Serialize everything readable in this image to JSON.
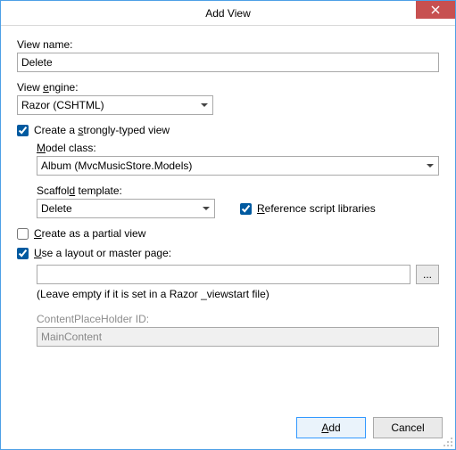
{
  "window": {
    "title": "Add View"
  },
  "fields": {
    "viewName": {
      "label": "View name:",
      "value": "Delete"
    },
    "viewEngine": {
      "label_pre": "View ",
      "label_u": "e",
      "label_post": "ngine:",
      "value": "Razor (CSHTML)"
    }
  },
  "strong": {
    "checkbox_pre": "Create a ",
    "checkbox_u": "s",
    "checkbox_post": "trongly-typed view",
    "checked": true,
    "modelClass": {
      "label_u": "M",
      "label_post": "odel class:",
      "value": "Album (MvcMusicStore.Models)"
    },
    "scaffold": {
      "label_pre": "Scaffol",
      "label_u": "d",
      "label_post": " template:",
      "value": "Delete"
    },
    "referenceScripts": {
      "checked": true,
      "label_u": "R",
      "label_post": "eference script libraries"
    }
  },
  "partial": {
    "checked": false,
    "label_u": "C",
    "label_post": "reate as a partial view"
  },
  "layout": {
    "checked": true,
    "label_u": "U",
    "label_post": "se a layout or master page:",
    "value": "",
    "browse": "...",
    "hint": "(Leave empty if it is set in a Razor _viewstart file)",
    "cph_label": "ContentPlaceHolder ID:",
    "cph_value": "MainContent"
  },
  "buttons": {
    "add_u": "A",
    "add_post": "dd",
    "cancel": "Cancel"
  }
}
